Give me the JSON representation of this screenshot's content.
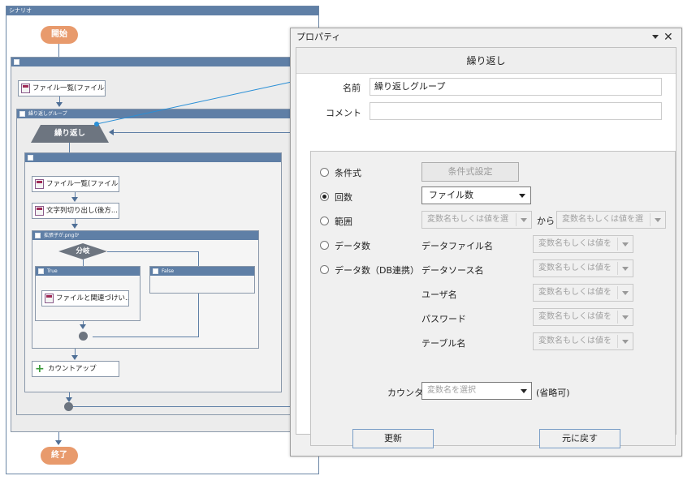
{
  "flow": {
    "title": "シナリオ",
    "start_label": "開始",
    "end_label": "終了",
    "actions": {
      "file_list_1": "ファイル一覧(ファイル数...",
      "file_list_2": "ファイル一覧(ファイル名...",
      "string_cut": "文字列切り出し(後方...",
      "file_assoc": "ファイルと関連づけい...",
      "count_up": "カウントアップ"
    },
    "loop_group_title": "繰り返しグループ",
    "loop_label": "繰り返し",
    "condition_group_title": "拡張子が.pngか",
    "branch_label": "分岐",
    "true_label": "True",
    "false_label": "False"
  },
  "property": {
    "title": "プロパティ",
    "header": "繰り返し",
    "name_label": "名前",
    "name_value": "繰り返しグループ",
    "comment_label": "コメント",
    "comment_value": "",
    "options": {
      "condition": "条件式",
      "count": "回数",
      "range": "範囲",
      "data_count": "データ数",
      "data_count_db": "データ数（DB連携）"
    },
    "condition_button": "条件式設定",
    "count_value": "ファイル数",
    "range_placeholder": "変数名もしくは値を選",
    "from_label": "から",
    "data_placeholder": "変数名もしくは値を",
    "data_file_label": "データファイル名",
    "data_source_label": "データソース名",
    "user_label": "ユーザ名",
    "password_label": "パスワード",
    "table_label": "テーブル名",
    "counter_label": "カウンタ",
    "counter_placeholder": "変数名を選択",
    "counter_optional": "(省略可)",
    "update_button": "更新",
    "revert_button": "元に戻す"
  },
  "colors": {
    "accent": "#5f7fa6",
    "start_end": "#e89a6c",
    "link_line": "#2a8fd6"
  }
}
